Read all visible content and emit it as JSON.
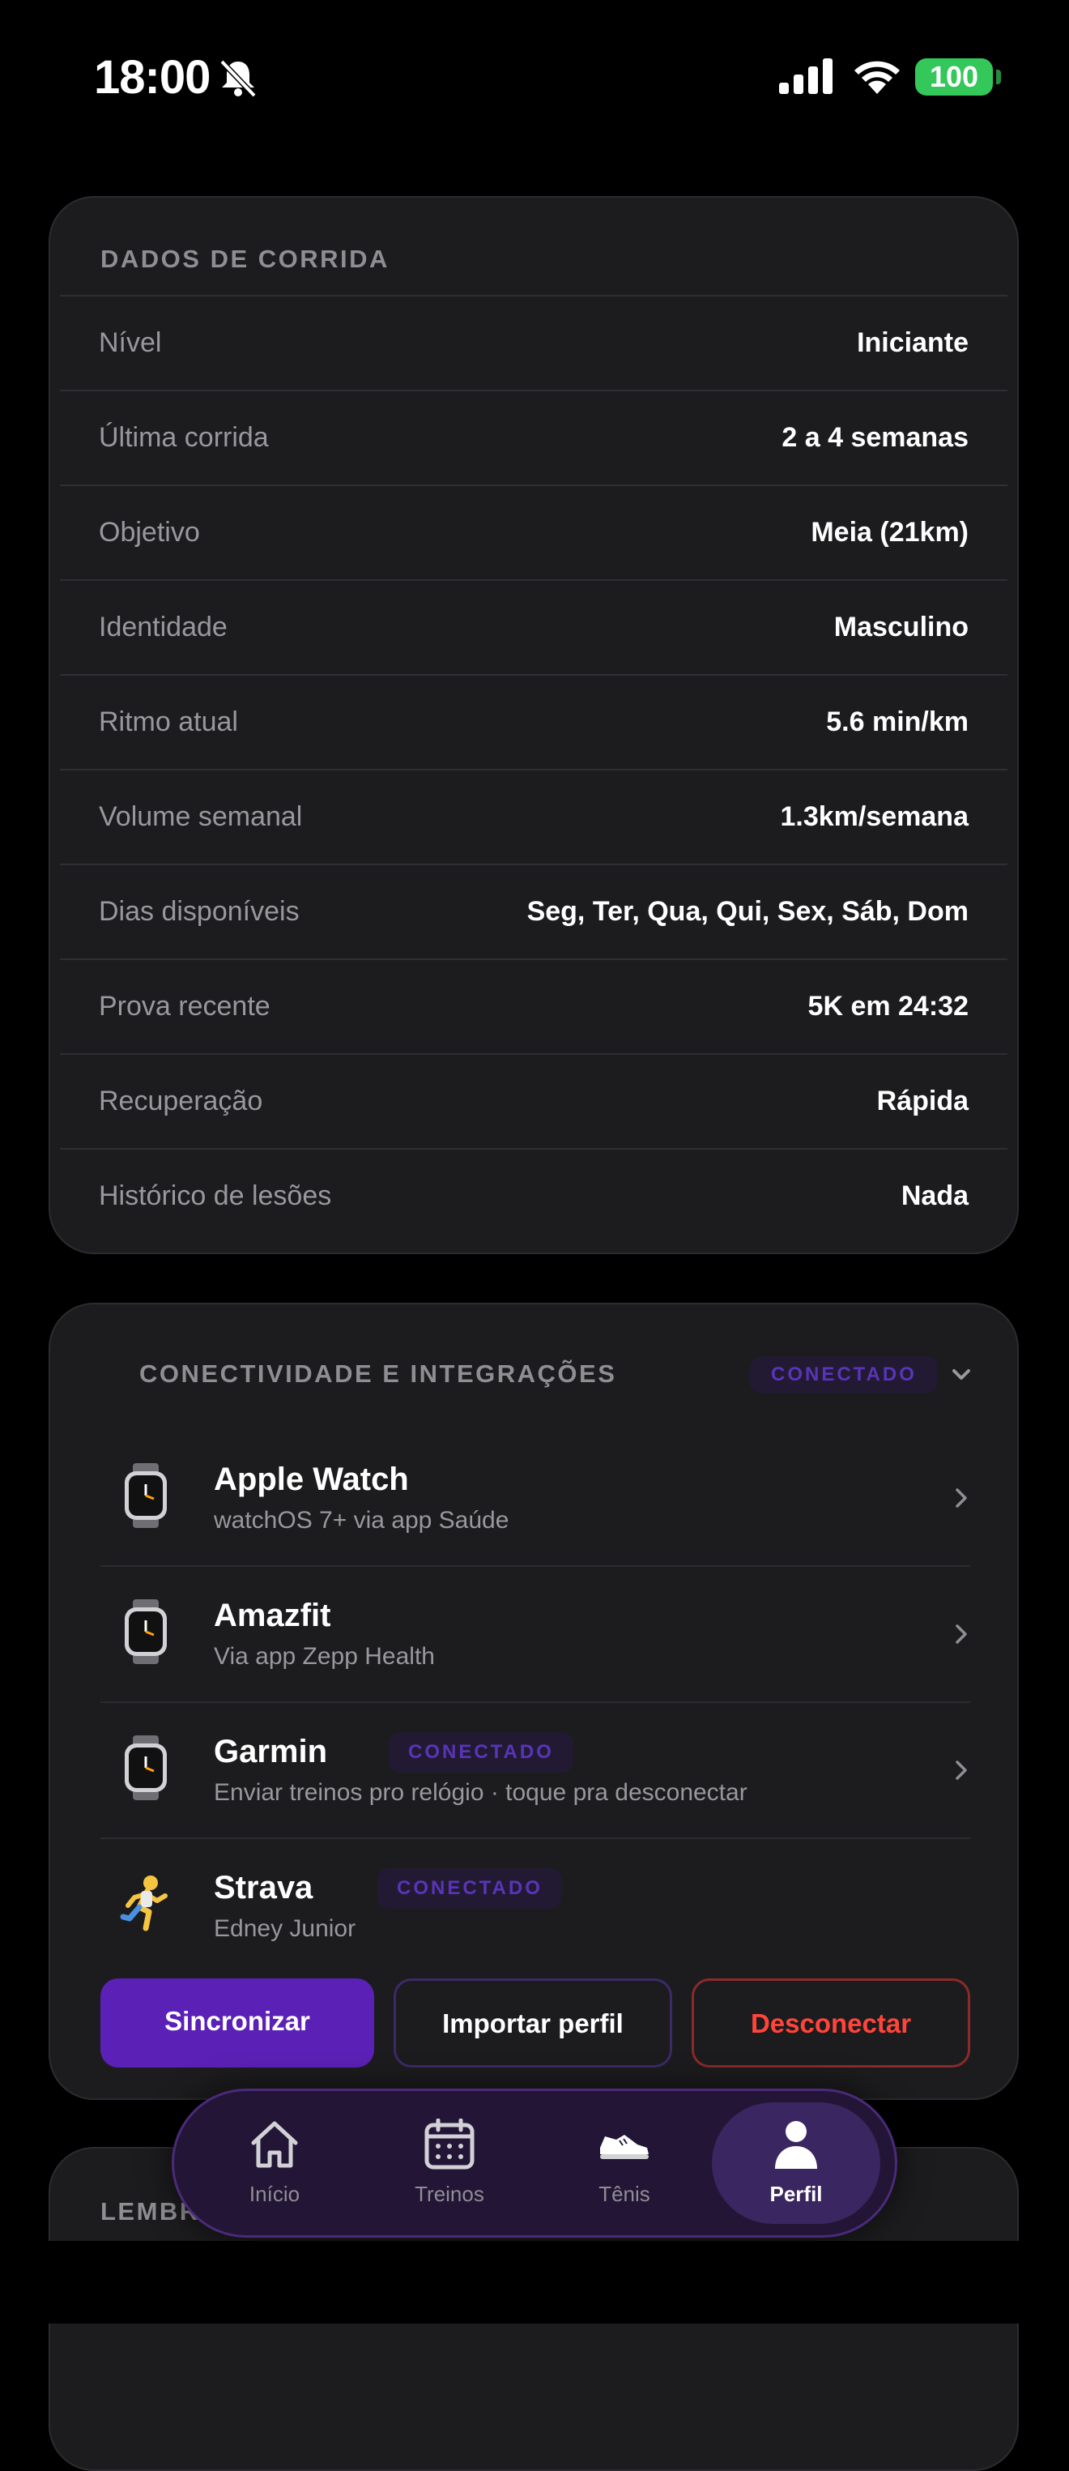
{
  "status_bar": {
    "time": "18:00",
    "battery": "100",
    "icons": [
      "bell-slash-icon",
      "signal-icon",
      "wifi-icon",
      "battery-icon"
    ]
  },
  "running_data": {
    "title": "DADOS DE CORRIDA",
    "rows": [
      {
        "label": "Nível",
        "value": "Iniciante"
      },
      {
        "label": "Última corrida",
        "value": "2 a 4 semanas"
      },
      {
        "label": "Objetivo",
        "value": "Meia (21km)"
      },
      {
        "label": "Identidade",
        "value": "Masculino"
      },
      {
        "label": "Ritmo atual",
        "value": "5.6 min/km"
      },
      {
        "label": "Volume semanal",
        "value": "1.3km/semana"
      },
      {
        "label": "Dias disponíveis",
        "value": "Seg, Ter, Qua, Qui, Sex, Sáb, Dom"
      },
      {
        "label": "Prova recente",
        "value": "5K em 24:32"
      },
      {
        "label": "Recuperação",
        "value": "Rápida"
      },
      {
        "label": "Histórico de lesões",
        "value": "Nada"
      }
    ]
  },
  "connectivity": {
    "title": "CONECTIVIDADE E INTEGRAÇÕES",
    "status_badge": "CONECTADO",
    "devices": [
      {
        "name": "Apple Watch",
        "subtitle": "watchOS 7+ via app Saúde",
        "icon": "watch-icon"
      },
      {
        "name": "Amazfit",
        "subtitle": "Via app Zepp Health",
        "icon": "watch-icon"
      },
      {
        "name": "Garmin",
        "badge": "CONECTADO",
        "subtitle": "Enviar treinos pro relógio · toque pra desconectar",
        "icon": "watch-icon"
      },
      {
        "name": "Strava",
        "badge": "CONECTADO",
        "subtitle": "Edney Junior",
        "icon": "runner-icon"
      }
    ],
    "buttons": {
      "sync": "Sincronizar",
      "import": "Importar perfil",
      "disconnect": "Desconectar"
    }
  },
  "reminders": {
    "title": "LEMBRETES DE TREINO"
  },
  "tab_bar": {
    "tabs": [
      {
        "label": "Início",
        "icon": "home-icon"
      },
      {
        "label": "Treinos",
        "icon": "calendar-icon"
      },
      {
        "label": "Tênis",
        "icon": "sneaker-icon"
      },
      {
        "label": "Perfil",
        "icon": "person-icon",
        "active": true
      }
    ]
  },
  "colors": {
    "accent": "#5b21b6",
    "danger": "#ff453a",
    "battery": "#34c759",
    "card_bg": "#1c1c1e"
  }
}
